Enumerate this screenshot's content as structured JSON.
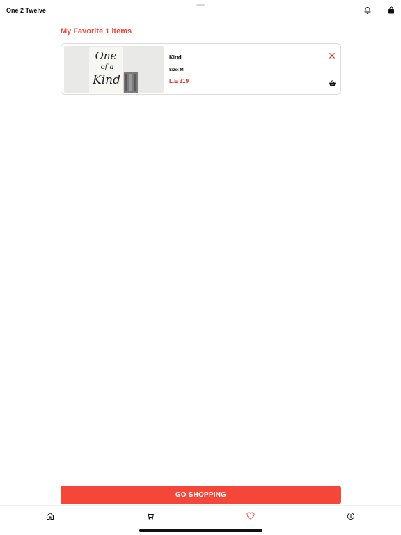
{
  "header": {
    "title": "One 2 Twelve",
    "icons": {
      "notifications": "bell-icon",
      "bag": "shopping-bag-icon"
    }
  },
  "favorites": {
    "heading": "My Favorite 1 items",
    "items": [
      {
        "name": "Kind",
        "size": "Size: M",
        "price": "L.E 319",
        "image_icon": "product-image",
        "image_text": [
          "One",
          "of a",
          "Kind"
        ]
      }
    ]
  },
  "actions": {
    "go_shopping": "GO SHOPPING"
  },
  "bottom_nav": {
    "items": [
      {
        "name": "home",
        "icon": "home-icon"
      },
      {
        "name": "cart",
        "icon": "cart-icon"
      },
      {
        "name": "favorites",
        "icon": "heart-icon",
        "active": true
      },
      {
        "name": "info",
        "icon": "info-icon"
      }
    ]
  },
  "colors": {
    "accent": "#f2483c",
    "price": "#d42a1f",
    "button": "#f5463a",
    "text": "#111111"
  }
}
